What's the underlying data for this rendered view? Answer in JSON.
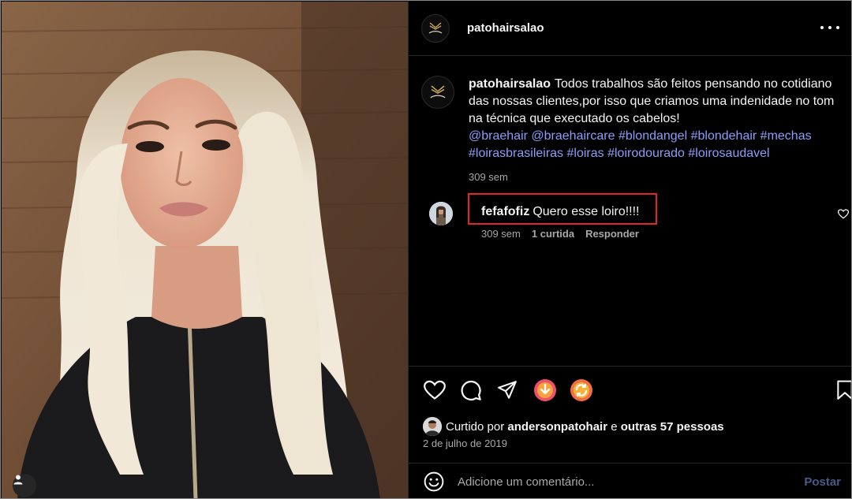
{
  "post": {
    "username": "patohairsalao",
    "caption_text": "Todos trabalhos são feitos pensando no cotidiano das nossas clientes,por isso que criamos uma indenidade no tom na técnica que executado os cabelos!",
    "hashtags": [
      "@braehair",
      "@braehaircare",
      "#blondangel",
      "#blondehair",
      "#mechas",
      "#loirasbrasileiras",
      "#loiras",
      "#loirodourado",
      "#loirosaudavel"
    ],
    "caption_time": "309 sem"
  },
  "comment": {
    "username": "fefafofiz",
    "text": "Quero esse loiro!!!!",
    "time": "309 sem",
    "likes": "1 curtida",
    "reply_label": "Responder"
  },
  "likes": {
    "prefix": "Curtido por",
    "user": "andersonpatohair",
    "middle": "e",
    "others": "outras 57 pessoas"
  },
  "date": "2 de julho de 2019",
  "add_comment": {
    "placeholder": "Adicione um comentário...",
    "post_label": "Postar"
  },
  "colors": {
    "background": "#000000",
    "hashtag": "#8b9df9",
    "highlight_box": "#e0262a",
    "muted_text": "#a8a8a8",
    "post_disabled": "#4a5a88"
  },
  "icons": [
    "more-icon",
    "heart-icon",
    "comment-icon",
    "share-icon",
    "download-extension-icon",
    "repost-extension-icon",
    "bookmark-icon",
    "emoji-icon",
    "user-tag-icon"
  ]
}
